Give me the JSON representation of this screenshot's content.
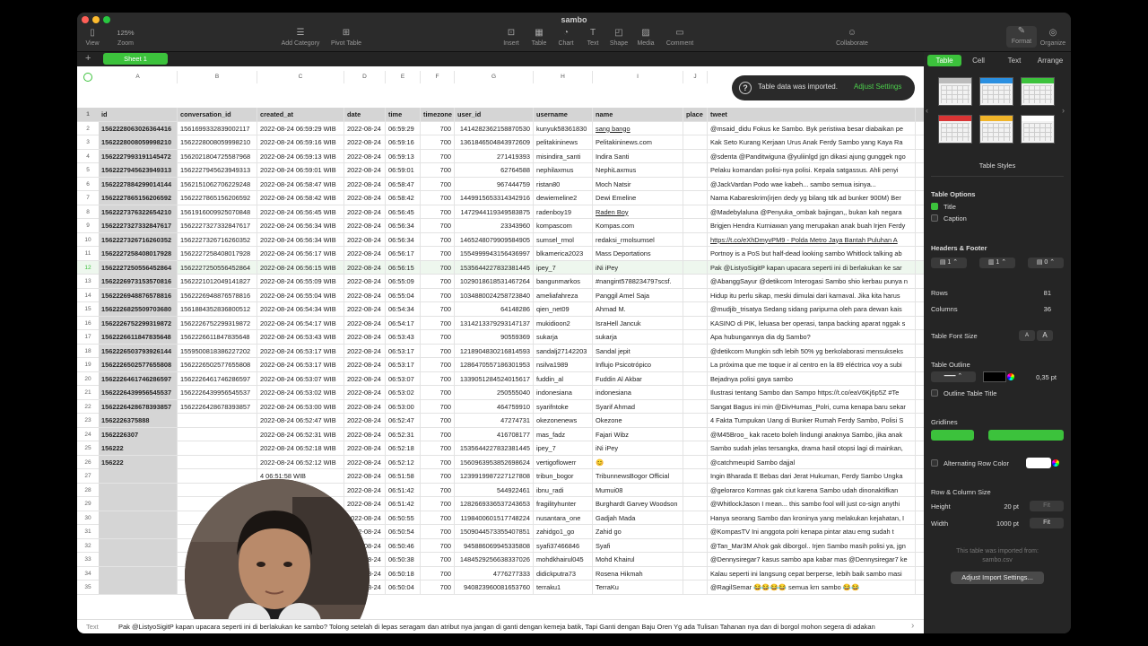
{
  "window": {
    "title": "sambo"
  },
  "toolbar": {
    "view": "View",
    "zoom_value": "125%",
    "zoom": "Zoom",
    "add_category": "Add Category",
    "pivot_table": "Pivot Table",
    "insert": "Insert",
    "table": "Table",
    "chart": "Chart",
    "text": "Text",
    "shape": "Shape",
    "media": "Media",
    "comment": "Comment",
    "collaborate": "Collaborate",
    "format": "Format",
    "organize": "Organize"
  },
  "sheet_tab": {
    "add": "+",
    "label": "Sheet 1"
  },
  "columns": [
    "A",
    "B",
    "C",
    "D",
    "E",
    "F",
    "G",
    "H",
    "I",
    "J"
  ],
  "toast": {
    "icon": "?",
    "message": "Table data was imported.",
    "action": "Adjust Settings"
  },
  "table": {
    "headers": [
      "id",
      "conversation_id",
      "created_at",
      "date",
      "time",
      "timezone",
      "user_id",
      "username",
      "name",
      "place",
      "tweet"
    ],
    "rows": [
      [
        "1562228063026364416",
        "1561699332839002117",
        "2022-08-24 06:59:29 WIB",
        "2022-08-24",
        "06:59:29",
        "700",
        "1414282362158870530",
        "kunyuk58361830",
        "sang bango",
        "",
        "@msaid_didu Fokus ke Sambo. Byk peristiwa besar diabaikan pe"
      ],
      [
        "1562228008059998210",
        "1562228008059998210",
        "2022-08-24 06:59:16 WIB",
        "2022-08-24",
        "06:59:16",
        "700",
        "1361846504843972609",
        "pelitakininews",
        "Pelitakininews.com",
        "",
        "Kak Seto Kurang Kerjaan Urus Anak Ferdy Sambo yang Kaya Ra"
      ],
      [
        "1562227993191145472",
        "1562021804725587968",
        "2022-08-24 06:59:13 WIB",
        "2022-08-24",
        "06:59:13",
        "700",
        "271419393",
        "misindira_santi",
        "Indira Santi",
        "",
        "@sdenta @Panditwiguna @yuliinlgd jgn dikasi ajung gunggek ngo"
      ],
      [
        "1562227945623949313",
        "1562227945623949313",
        "2022-08-24 06:59:01 WIB",
        "2022-08-24",
        "06:59:01",
        "700",
        "62764588",
        "nephilaxmus",
        "NephiLaxmus",
        "",
        "Pelaku komandan polisi-nya polisi.  Kepala satgassus.  Ahli penyi"
      ],
      [
        "1562227884299014144",
        "1562151062706229248",
        "2022-08-24 06:58:47 WIB",
        "2022-08-24",
        "06:58:47",
        "700",
        "967444759",
        "ristan80",
        "Moch Natsir",
        "",
        "@JackVardan Podo wae kabeh... sambo semua isinya..."
      ],
      [
        "1562227865156206592",
        "1562227865156206592",
        "2022-08-24 06:58:42 WIB",
        "2022-08-24",
        "06:58:42",
        "700",
        "1449915653314342916",
        "dewiemeline2",
        "Dewi Emeline",
        "",
        "Nama Kabareskrim(irjen dedy yg bilang tdk ad bunker 900M) Ber"
      ],
      [
        "1562227376322654210",
        "1561916009925070848",
        "2022-08-24 06:56:45 WIB",
        "2022-08-24",
        "06:56:45",
        "700",
        "1472944119349583875",
        "radenboy19",
        "Raden Boy",
        "",
        "@Madebylaluna @Penyuka_ombak bajingan,,  bukan  kah  negara"
      ],
      [
        "1562227327332847617",
        "1562227327332847617",
        "2022-08-24 06:56:34 WIB",
        "2022-08-24",
        "06:56:34",
        "700",
        "23343960",
        "kompascom",
        "Kompas.com",
        "",
        "Brigjen Hendra Kurniawan yang merupakan anak buah Irjen Ferdy"
      ],
      [
        "1562227326716260352",
        "1562227326716260352",
        "2022-08-24 06:56:34 WIB",
        "2022-08-24",
        "06:56:34",
        "700",
        "1465248079909584905",
        "sumsel_rmol",
        "redaksi_rmolsumsel",
        "",
        "https://t.co/eXhDmyvPM9 -  Polda Metro Jaya Bantah Puluhan A"
      ],
      [
        "1562227258408017928",
        "1562227258408017928",
        "2022-08-24 06:56:17 WIB",
        "2022-08-24",
        "06:56:17",
        "700",
        "1554999943156436997",
        "blkamerica2023",
        "Mass Deportations",
        "",
        "Portnoy is a PoS but half-dead looking sambo Whitlock talking ab"
      ],
      [
        "1562227250556452864",
        "1562227250556452864",
        "2022-08-24 06:56:15 WIB",
        "2022-08-24",
        "06:56:15",
        "700",
        "1535644227832381445",
        "ipey_7",
        "iNi iPey",
        "",
        "Pak @ListyoSigitP  kapan upacara seperti ini di berlakukan ke sar"
      ],
      [
        "1562226973153570816",
        "1562221012049141827",
        "2022-08-24 06:55:09 WIB",
        "2022-08-24",
        "06:55:09",
        "700",
        "1029018618531467264",
        "bangunmarkos",
        "#nangint5788234797scsf.",
        "",
        "@AbanggSayur @detikcom Interogasi Sambo shio kerbau punya n"
      ],
      [
        "1562226948876578816",
        "1562226948876578816",
        "2022-08-24 06:55:04 WIB",
        "2022-08-24",
        "06:55:04",
        "700",
        "1034880024258723840",
        "ameliafahreza",
        "Panggil Amel Saja",
        "",
        "Hidup itu perlu sikap, meski dimulai dari karnaval.  Jika kita harus"
      ],
      [
        "1562226825509703680",
        "1561884352836800512",
        "2022-08-24 06:54:34 WIB",
        "2022-08-24",
        "06:54:34",
        "700",
        "64148286",
        "qien_net09",
        "Ahmad M.",
        "",
        "@mudjib_trisatya Sedang sidang paripurna  oleh para dewan kais"
      ],
      [
        "1562226752299319872",
        "1562226752299319872",
        "2022-08-24 06:54:17 WIB",
        "2022-08-24",
        "06:54:17",
        "700",
        "1314213379293147137",
        "mukidioon2",
        "IsraHell Jancuk",
        "",
        "KASINO di PIK, leluasa ber operasi, tanpa backing aparat nggak s"
      ],
      [
        "1562226611847835648",
        "1562226611847835648",
        "2022-08-24 06:53:43 WIB",
        "2022-08-24",
        "06:53:43",
        "700",
        "90559369",
        "sukarja",
        "sukarja",
        "",
        "Apa hubungannya dia dg Sambo?"
      ],
      [
        "1562226503793926144",
        "1559500818386227202",
        "2022-08-24 06:53:17 WIB",
        "2022-08-24",
        "06:53:17",
        "700",
        "1218904830216814593",
        "sandalj27142203",
        "Sandal jepit",
        "",
        "@detikcom Mungkin sdh lebih 50% yg berkolaborasi mensukseks"
      ],
      [
        "1562226502577655808",
        "1562226502577655808",
        "2022-08-24 06:53:17 WIB",
        "2022-08-24",
        "06:53:17",
        "700",
        "1286470557186301953",
        "nsilva1989",
        "Influjo Psicotrópico",
        "",
        "La próxima que me toque ir al centro en la 89 eléctrica voy a subi"
      ],
      [
        "1562226461746286597",
        "1562226461746286597",
        "2022-08-24 06:53:07 WIB",
        "2022-08-24",
        "06:53:07",
        "700",
        "1339051284524015617",
        "fuddin_al",
        "Fuddin Al Akbar",
        "",
        "Bejadnya polisi gaya sambo"
      ],
      [
        "1562226439956545537",
        "1562226439956545537",
        "2022-08-24 06:53:02 WIB",
        "2022-08-24",
        "06:53:02",
        "700",
        "250555040",
        "indonesiana",
        "indonesiana",
        "",
        "Ilustrasi tentang Sambo dan Sampo  https://t.co/eaV6Kj6p5Z #Te"
      ],
      [
        "1562226428678393857",
        "1562226428678393857",
        "2022-08-24 06:53:00 WIB",
        "2022-08-24",
        "06:53:00",
        "700",
        "464759910",
        "syarifntoke",
        "Syarif Ahmad",
        "",
        "Sangat Bagus ini min @DivHumas_Polri, cuma kenapa baru sekar"
      ],
      [
        "1562226375888",
        "",
        "2022-08-24 06:52:47 WIB",
        "2022-08-24",
        "06:52:47",
        "700",
        "47274731",
        "okezonenews",
        "Okezone",
        "",
        "4 Fakta Tumpukan Uang di Bunker Rumah Ferdy Sambo, Polisi S"
      ],
      [
        "1562226307",
        "",
        "2022-08-24 06:52:31 WIB",
        "2022-08-24",
        "06:52:31",
        "700",
        "416708177",
        "mas_fadz",
        "Fajari Wibz",
        "",
        "@M45Broo_ kak raceto boleh lindungi anaknya Sambo, jika anak"
      ],
      [
        "156222",
        "",
        "2022-08-24 06:52:18 WIB",
        "2022-08-24",
        "06:52:18",
        "700",
        "1535644227832381445",
        "ipey_7",
        "iNi iPey",
        "",
        "Sambo sudah jelas tersangka, drama hasil otopsi lagi di mainkan,"
      ],
      [
        "156222",
        "",
        "2022-08-24 06:52:12 WIB",
        "2022-08-24",
        "06:52:12",
        "700",
        "1560963953852698624",
        "vertigoflowerr",
        "😊",
        "",
        "@catchmeupid Sambo dajjal"
      ],
      [
        "",
        "",
        "4 06:51:58 WIB",
        "2022-08-24",
        "06:51:58",
        "700",
        "1239919987227127808",
        "tribun_bogor",
        "TribunnewsBogor Official",
        "",
        "Ingin Bharada E Bebas dari Jerat Hukuman, Ferdy Sambo Ungka"
      ],
      [
        "",
        "",
        "4 06:51:42 WIB",
        "2022-08-24",
        "06:51:42",
        "700",
        "544922461",
        "ibnu_radi",
        "Mumui08",
        "",
        "@gelorarco Komnas gak ciut karena Sambo udah dinonaktifkan"
      ],
      [
        "",
        "",
        "4 06:51:42 WIB",
        "2022-08-24",
        "06:51:42",
        "700",
        "1282669336537243653",
        "fragilityhunter",
        "Burghardt Garvey Woodson",
        "",
        "@WhitlockJason I mean... this sambo fool will just co-sign anythi"
      ],
      [
        "",
        "",
        "4 06:50:55 WIB",
        "2022-08-24",
        "06:50:55",
        "700",
        "1198400601517748224",
        "nusantara_one",
        "Gadjah Mada",
        "",
        "Hanya seorang Sambo dan kroninya yang melakukan kejahatan, I"
      ],
      [
        "",
        "",
        "4 06:50:54 WIB",
        "2022-08-24",
        "06:50:54",
        "700",
        "1509044573355407851",
        "zahidgo1_go",
        "Zahid go",
        "",
        "@KompasTV Ini anggota polri kenapa pintar atau emg sudah t"
      ],
      [
        "",
        "",
        "4 06:50:46 WIB",
        "2022-08-24",
        "06:50:46",
        "700",
        "945886069945335808",
        "syafi37466846",
        "Syafi",
        "",
        "@Tan_Mar3M Ahok gak diborgol.. Irjen Sambo masih polisi ya, jgn"
      ],
      [
        "",
        "",
        "4 06:50:38 WIB",
        "2022-08-24",
        "06:50:38",
        "700",
        "1484529256638337026",
        "mohdkhairul045",
        "Mohd Khairul",
        "",
        "@Dennysiregar7 kasus sambo apa kabar mas @Dennysiregar7 ke"
      ],
      [
        "",
        "",
        "4 06:50:18 WIB",
        "2022-08-24",
        "06:50:18",
        "700",
        "4776277333",
        "didickputra73",
        "Rosena Hikmah",
        "",
        "Kalau seperti ini langsung cepat berperse, Iebih baik sambo masi"
      ],
      [
        "",
        "",
        "4 06:50:04 WIB",
        "2022-08-24",
        "06:50:04",
        "700",
        "940823960081653760",
        "terraku1",
        "TerraKu",
        "",
        "@RagilSemar 😂😂😂😂 semua krn sambo 😂😂"
      ]
    ]
  },
  "textbar": {
    "label": "Text",
    "value": "Pak @ListyoSigitP  kapan upacara seperti ini di berlakukan ke sambo? Tolong setelah di lepas seragam dan atribut nya jangan di ganti dengan kemeja batik, Tapi Ganti dengan Baju Oren Yg ada Tulisan Tahanan nya dan di borgol mohon segera di adakan"
  },
  "inspector": {
    "tabs": [
      "Table",
      "Cell",
      "Text",
      "Arrange"
    ],
    "table_styles_label": "Table Styles",
    "table_options": "Table Options",
    "title_option": "Title",
    "caption_option": "Caption",
    "headers_footer": "Headers & Footer",
    "header_rows": "1",
    "header_cols": "1",
    "footer_rows": "0",
    "rows_label": "Rows",
    "rows_value": "81",
    "columns_label": "Columns",
    "columns_value": "36",
    "font_size_label": "Table Font Size",
    "font_small": "A",
    "font_large": "A",
    "outline_label": "Table Outline",
    "outline_value": "0,35 pt",
    "outline_title": "Outline Table Title",
    "gridlines": "Gridlines",
    "alt_row": "Alternating Row Color",
    "row_col_size": "Row & Column Size",
    "height_label": "Height",
    "height_value": "20 pt",
    "fit1": "Fit",
    "width_label": "Width",
    "width_value": "1000 pt",
    "fit2": "Fit",
    "import_note_1": "This table was imported from:",
    "import_note_2": "sambo.csv",
    "adjust_import": "Adjust Import Settings..."
  }
}
